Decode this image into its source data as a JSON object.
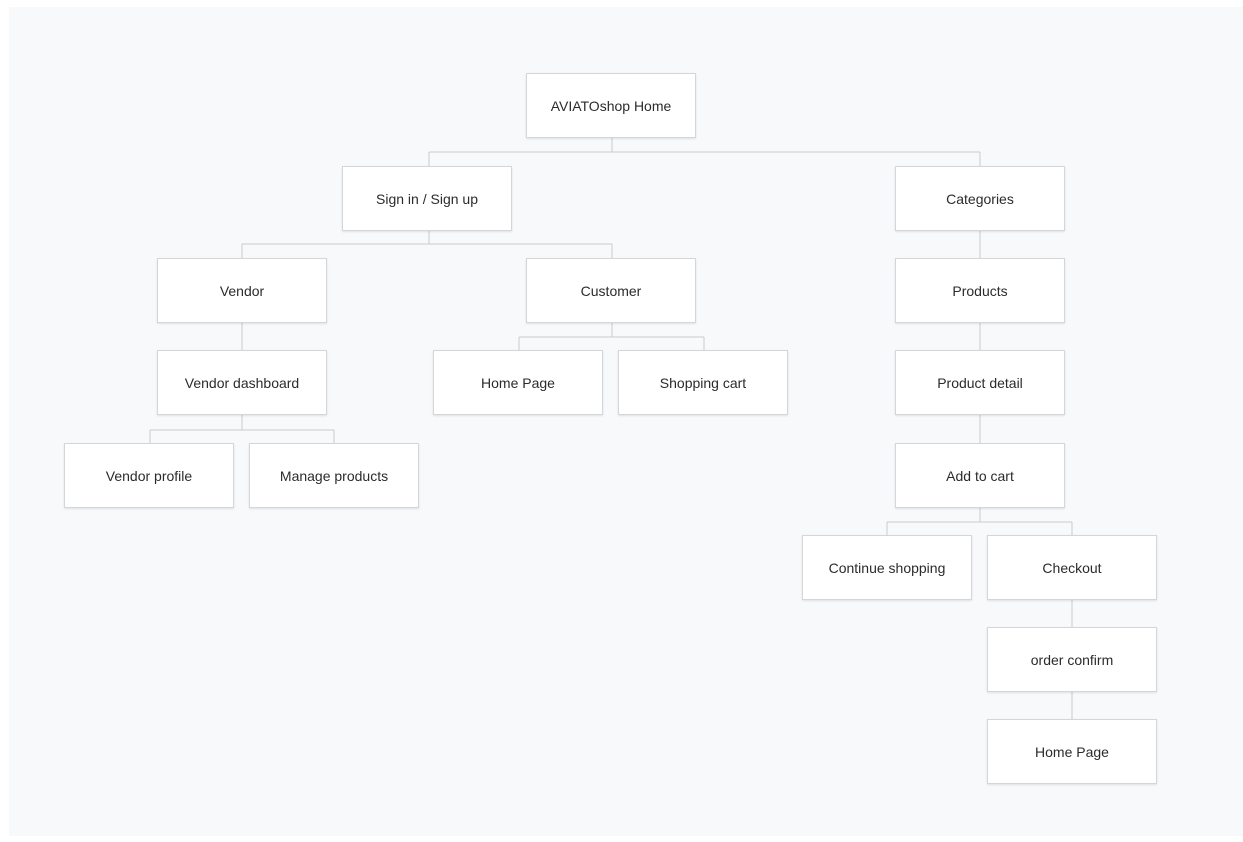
{
  "diagram": {
    "nodes": {
      "home": "AVIATOshop Home",
      "signin": "Sign in / Sign up",
      "categories": "Categories",
      "vendor": "Vendor",
      "customer": "Customer",
      "products": "Products",
      "vendor_dashboard": "Vendor dashboard",
      "customer_home": "Home Page",
      "shopping_cart": "Shopping cart",
      "product_detail": "Product detail",
      "vendor_profile": "Vendor profile",
      "manage_products": "Manage products",
      "add_to_cart": "Add to cart",
      "continue_shopping": "Continue shopping",
      "checkout": "Checkout",
      "order_confirm": "order confirm",
      "final_home": "Home Page"
    },
    "edges": [
      [
        "home",
        "signin"
      ],
      [
        "home",
        "categories"
      ],
      [
        "signin",
        "vendor"
      ],
      [
        "signin",
        "customer"
      ],
      [
        "vendor",
        "vendor_dashboard"
      ],
      [
        "vendor_dashboard",
        "vendor_profile"
      ],
      [
        "vendor_dashboard",
        "manage_products"
      ],
      [
        "customer",
        "customer_home"
      ],
      [
        "customer",
        "shopping_cart"
      ],
      [
        "categories",
        "products"
      ],
      [
        "products",
        "product_detail"
      ],
      [
        "product_detail",
        "add_to_cart"
      ],
      [
        "add_to_cart",
        "continue_shopping"
      ],
      [
        "add_to_cart",
        "checkout"
      ],
      [
        "checkout",
        "order_confirm"
      ],
      [
        "order_confirm",
        "final_home"
      ]
    ]
  }
}
